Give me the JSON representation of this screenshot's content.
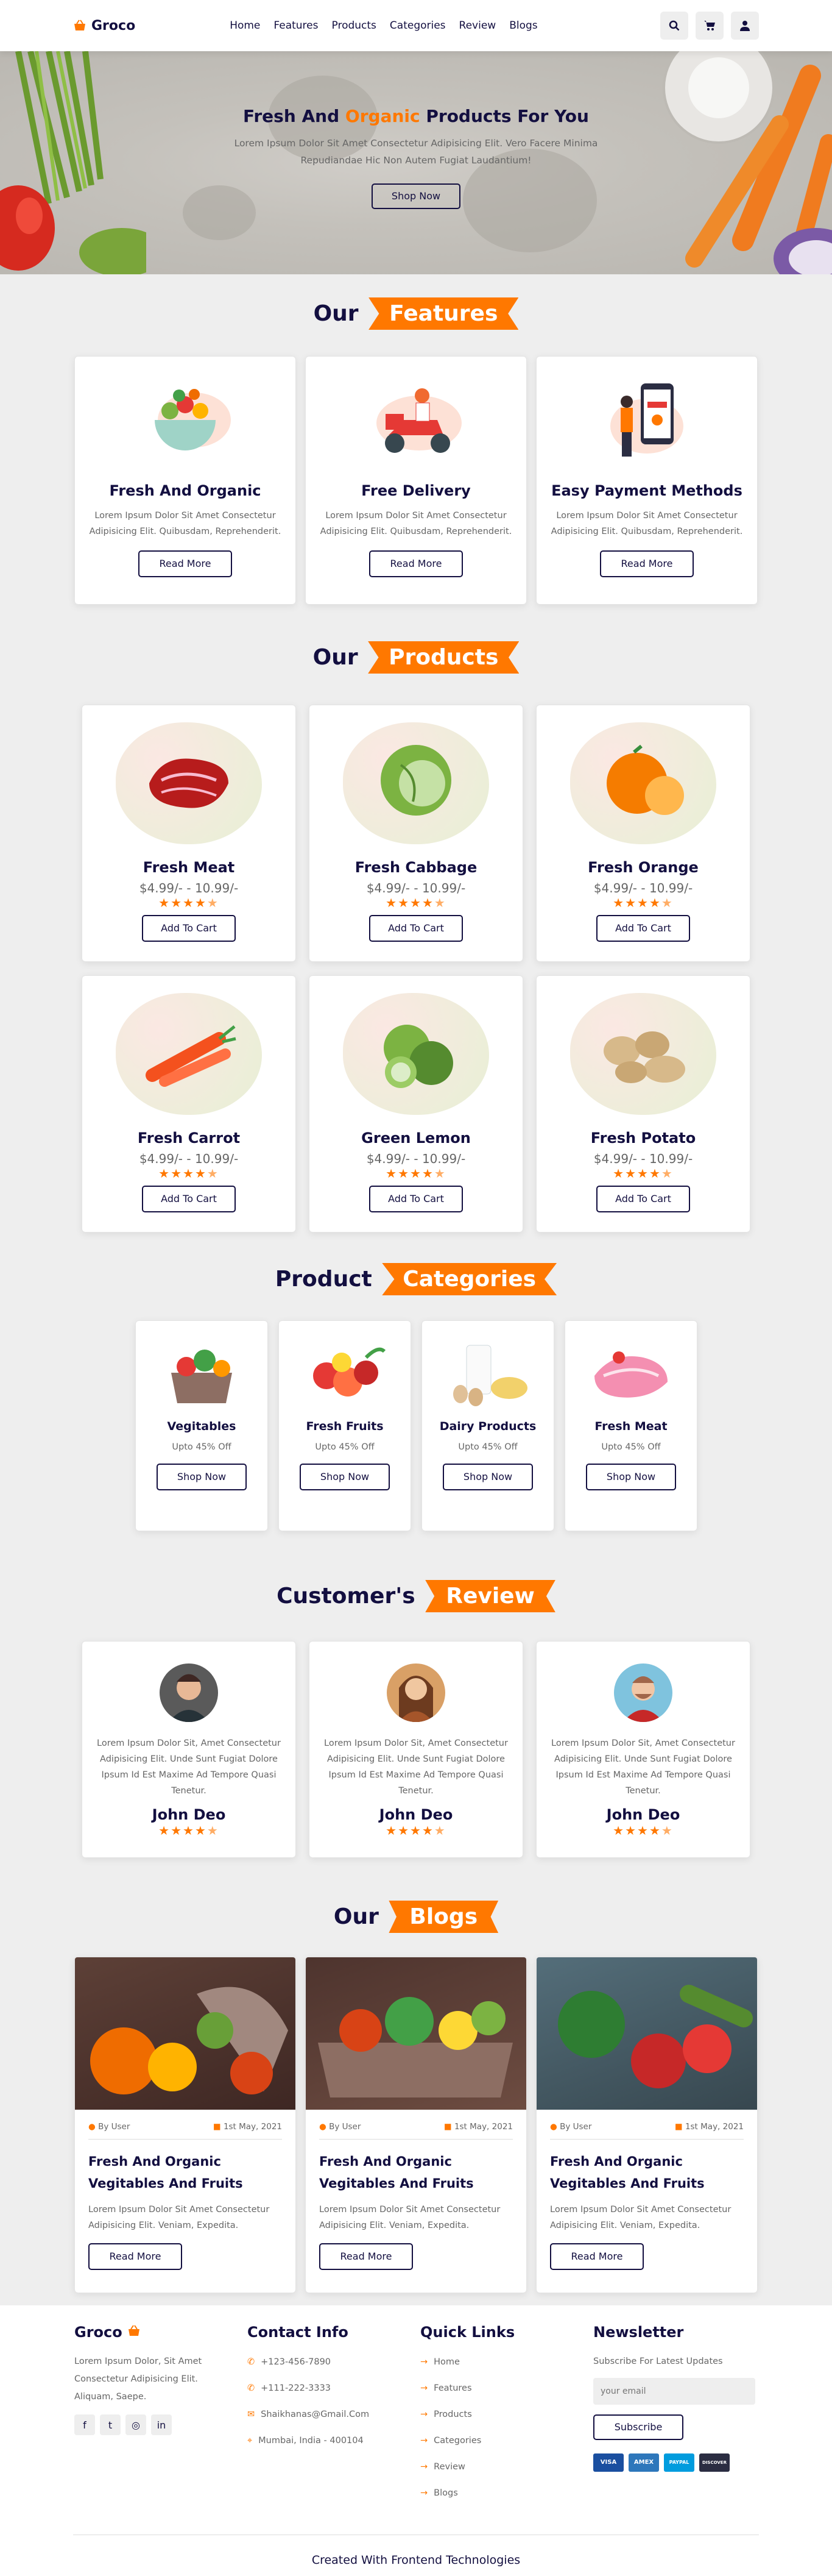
{
  "header": {
    "logo": "Groco",
    "nav": [
      "Home",
      "Features",
      "Products",
      "Categories",
      "Review",
      "Blogs"
    ],
    "icons": [
      "search-icon",
      "shopping-cart-icon",
      "user-icon"
    ]
  },
  "hero": {
    "title_pre": "Fresh And ",
    "title_accent": "Organic",
    "title_post": " Products For You",
    "text": "Lorem Ipsum Dolor Sit Amet Consectetur Adipisicing Elit. Vero Facere Minima Repudiandae Hic Non Autem Fugiat Laudantium!",
    "button": "Shop Now"
  },
  "features": {
    "heading_pre": "Our",
    "heading_tag": "Features",
    "items": [
      {
        "title": "Fresh And Organic",
        "text": "Lorem Ipsum Dolor Sit Amet Consectetur Adipisicing Elit. Quibusdam, Reprehenderit.",
        "button": "Read More"
      },
      {
        "title": "Free Delivery",
        "text": "Lorem Ipsum Dolor Sit Amet Consectetur Adipisicing Elit. Quibusdam, Reprehenderit.",
        "button": "Read More"
      },
      {
        "title": "Easy Payment Methods",
        "text": "Lorem Ipsum Dolor Sit Amet Consectetur Adipisicing Elit. Quibusdam, Reprehenderit.",
        "button": "Read More"
      }
    ]
  },
  "products": {
    "heading_pre": "Our",
    "heading_tag": "Products",
    "items": [
      {
        "name": "Fresh Meat",
        "price": "$4.99/- - 10.99/-",
        "rating": 4.5,
        "button": "Add To Cart"
      },
      {
        "name": "Fresh Cabbage",
        "price": "$4.99/- - 10.99/-",
        "rating": 4.5,
        "button": "Add To Cart"
      },
      {
        "name": "Fresh Orange",
        "price": "$4.99/- - 10.99/-",
        "rating": 4.5,
        "button": "Add To Cart"
      },
      {
        "name": "Fresh Carrot",
        "price": "$4.99/- - 10.99/-",
        "rating": 4.5,
        "button": "Add To Cart"
      },
      {
        "name": "Green Lemon",
        "price": "$4.99/- - 10.99/-",
        "rating": 4.5,
        "button": "Add To Cart"
      },
      {
        "name": "Fresh Potato",
        "price": "$4.99/- - 10.99/-",
        "rating": 4.5,
        "button": "Add To Cart"
      }
    ]
  },
  "categories": {
    "heading_pre": "Product",
    "heading_tag": "Categories",
    "items": [
      {
        "name": "Vegitables",
        "offer": "Upto 45% Off",
        "button": "Shop Now"
      },
      {
        "name": "Fresh Fruits",
        "offer": "Upto 45% Off",
        "button": "Shop Now"
      },
      {
        "name": "Dairy Products",
        "offer": "Upto 45% Off",
        "button": "Shop Now"
      },
      {
        "name": "Fresh Meat",
        "offer": "Upto 45% Off",
        "button": "Shop Now"
      }
    ]
  },
  "review": {
    "heading_pre": "Customer's",
    "heading_tag": "Review",
    "items": [
      {
        "text": "Lorem Ipsum Dolor Sit, Amet Consectetur Adipisicing Elit. Unde Sunt Fugiat Dolore Ipsum Id Est Maxime Ad Tempore Quasi Tenetur.",
        "name": "John Deo",
        "rating": 4.5
      },
      {
        "text": "Lorem Ipsum Dolor Sit, Amet Consectetur Adipisicing Elit. Unde Sunt Fugiat Dolore Ipsum Id Est Maxime Ad Tempore Quasi Tenetur.",
        "name": "John Deo",
        "rating": 4.5
      },
      {
        "text": "Lorem Ipsum Dolor Sit, Amet Consectetur Adipisicing Elit. Unde Sunt Fugiat Dolore Ipsum Id Est Maxime Ad Tempore Quasi Tenetur.",
        "name": "John Deo",
        "rating": 4.5
      }
    ]
  },
  "blogs": {
    "heading_pre": "Our",
    "heading_tag": "Blogs",
    "items": [
      {
        "user": "By User",
        "date": "1st May, 2021",
        "title": "Fresh And Organic Vegitables And Fruits",
        "text": "Lorem Ipsum Dolor Sit Amet Consectetur Adipisicing Elit. Veniam, Expedita.",
        "button": "Read More"
      },
      {
        "user": "By User",
        "date": "1st May, 2021",
        "title": "Fresh And Organic Vegitables And Fruits",
        "text": "Lorem Ipsum Dolor Sit Amet Consectetur Adipisicing Elit. Veniam, Expedita.",
        "button": "Read More"
      },
      {
        "user": "By User",
        "date": "1st May, 2021",
        "title": "Fresh And Organic Vegitables And Fruits",
        "text": "Lorem Ipsum Dolor Sit Amet Consectetur Adipisicing Elit. Veniam, Expedita.",
        "button": "Read More"
      }
    ]
  },
  "footer": {
    "about_title": "Groco",
    "about_text": "Lorem Ipsum Dolor, Sit Amet Consectetur Adipisicing Elit. Aliquam, Saepe.",
    "social": [
      "facebook-icon",
      "twitter-icon",
      "instagram-icon",
      "linkedin-icon"
    ],
    "contact_title": "Contact Info",
    "contact": [
      "+123-456-7890",
      "+111-222-3333",
      "Shaikhanas@Gmail.Com",
      "Mumbai, India - 400104"
    ],
    "links_title": "Quick Links",
    "links": [
      "Home",
      "Features",
      "Products",
      "Categories",
      "Review",
      "Blogs"
    ],
    "news_title": "Newsletter",
    "news_text": "Subscribe For Latest Updates",
    "email_placeholder": "your email",
    "subscribe": "Subscribe",
    "payments": [
      "VISA",
      "AMEX",
      "PAYPAL",
      "DISCOVER"
    ],
    "credit": "Created With Frontend Technologies"
  },
  "colors": {
    "accent": "#ff7800",
    "navy": "#130f40",
    "bg": "#eeeeee"
  }
}
